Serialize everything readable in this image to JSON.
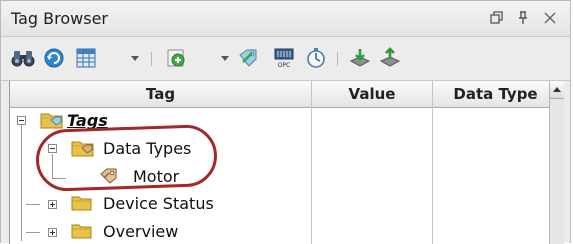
{
  "window": {
    "title": "Tag Browser",
    "controls": [
      "restore-icon",
      "pin-icon",
      "close-icon"
    ]
  },
  "toolbar": {
    "buttons": [
      "binoculars-icon",
      "refresh-icon",
      "grid-icon",
      "new-tag-icon",
      "edit-tag-icon",
      "opc-icon",
      "timer-icon",
      "import-icon",
      "export-icon"
    ],
    "opc_label": "OPC"
  },
  "table": {
    "columns": [
      "Tag",
      "Value",
      "Data Type"
    ],
    "rows": [
      {
        "label": "Tags",
        "level": 0,
        "expander": "minus",
        "icon": "tags-folder-icon"
      },
      {
        "label": "Data Types",
        "level": 1,
        "expander": "minus",
        "icon": "data-types-folder-icon"
      },
      {
        "label": "Motor",
        "level": 2,
        "expander": "none",
        "icon": "udt-icon"
      },
      {
        "label": "Device Status",
        "level": 1,
        "expander": "plus",
        "icon": "folder-icon"
      },
      {
        "label": "Overview",
        "level": 1,
        "expander": "plus",
        "icon": "folder-icon"
      }
    ]
  },
  "colors": {
    "highlight": "#a3282a",
    "folder": "#e9c24a"
  }
}
